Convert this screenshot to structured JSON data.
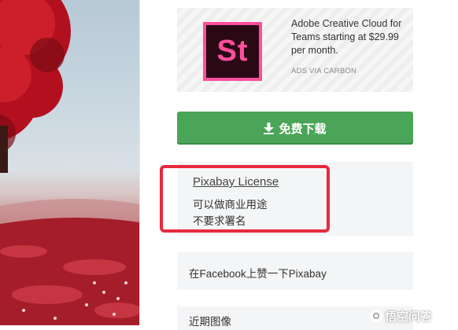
{
  "photo": {
    "alt": "red tree field photo",
    "icon": "photo-image"
  },
  "ad": {
    "logo_text": "St",
    "headline": "Adobe Creative Cloud for Teams starting at $29.99 per month.",
    "via": "ADS VIA CARBON",
    "colors": {
      "logo_bg": "#2a0915",
      "logo_accent": "#ff4f9c"
    }
  },
  "download": {
    "label": "免费下载",
    "icon": "download-arrow-icon",
    "color": "#4aa558"
  },
  "license": {
    "title": "Pixabay License",
    "lines": [
      "可以做商业用途",
      "不要求署名"
    ],
    "highlight_color": "#e8293e"
  },
  "facebook": {
    "label": "在Facebook上赞一下Pixabay"
  },
  "recent": {
    "label": "近期图像"
  },
  "watermark": {
    "text": "悟空问答",
    "icon": "wukong-logo-icon"
  }
}
